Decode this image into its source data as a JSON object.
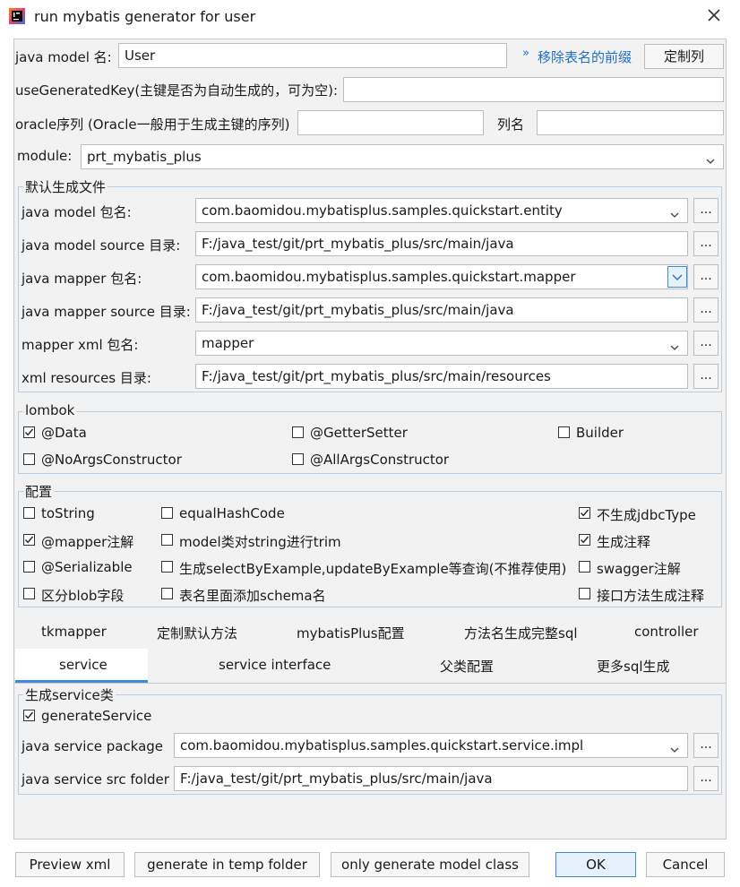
{
  "window": {
    "title": "run mybatis generator for user"
  },
  "model_row": {
    "label": "java model 名:",
    "value": "User",
    "remove_prefix_link": "移除表名的前缀",
    "custom_columns_button": "定制列"
  },
  "generated_key": {
    "label": "useGeneratedKey(主键是否为自动生成的，可为空):",
    "value": ""
  },
  "oracle": {
    "label": "oracle序列 (Oracle一般用于生成主键的序列)",
    "value": "",
    "column_label": "列名",
    "column_value": ""
  },
  "module": {
    "label": "module:",
    "value": "prt_mybatis_plus"
  },
  "default_files": {
    "title": "默认生成文件",
    "rows": [
      {
        "label": "java model 包名:",
        "value": "com.baomidou.mybatisplus.samples.quickstart.entity"
      },
      {
        "label": "java model source 目录:",
        "value": "F:/java_test/git/prt_mybatis_plus/src/main/java"
      },
      {
        "label": "java mapper 包名:",
        "value": "com.baomidou.mybatisplus.samples.quickstart.mapper"
      },
      {
        "label": "java mapper source 目录:",
        "value": "F:/java_test/git/prt_mybatis_plus/src/main/java"
      },
      {
        "label": "mapper xml 包名:",
        "value": "mapper"
      },
      {
        "label": "xml resources 目录:",
        "value": "F:/java_test/git/prt_mybatis_plus/src/main/resources"
      }
    ],
    "browse_label": "..."
  },
  "lombok": {
    "title": "lombok",
    "data": {
      "label": "@Data",
      "checked": true
    },
    "getter_setter": {
      "label": "@GetterSetter",
      "checked": false
    },
    "builder": {
      "label": "Builder",
      "checked": false
    },
    "no_args": {
      "label": "@NoArgsConstructor",
      "checked": false
    },
    "all_args": {
      "label": "@AllArgsConstructor",
      "checked": false
    }
  },
  "config": {
    "title": "配置",
    "to_string": {
      "label": "toString",
      "checked": false
    },
    "equal_hash_code": {
      "label": "equalHashCode",
      "checked": false
    },
    "no_jdbc_type": {
      "label": "不生成jdbcType",
      "checked": true
    },
    "mapper_annotation": {
      "label": "@mapper注解",
      "checked": true
    },
    "string_trim": {
      "label": "model类对string进行trim",
      "checked": false
    },
    "gen_comments": {
      "label": "生成注释",
      "checked": true
    },
    "serializable": {
      "label": "@Serializable",
      "checked": false
    },
    "select_by_example": {
      "label": "生成selectByExample,updateByExample等查询(不推荐使用)",
      "checked": false
    },
    "swagger": {
      "label": "swagger注解",
      "checked": false
    },
    "blob": {
      "label": "区分blob字段",
      "checked": false
    },
    "schema": {
      "label": "表名里面添加schema名",
      "checked": false
    },
    "interface_comments": {
      "label": "接口方法生成注释",
      "checked": false
    }
  },
  "tabs": {
    "tkmapper": "tkmapper",
    "custom_default": "定制默认方法",
    "mybatis_plus": "mybatisPlus配置",
    "full_sql": "方法名生成完整sql",
    "controller": "controller",
    "service": "service",
    "service_interface": "service interface",
    "parent_class": "父类配置",
    "more_sql": "更多sql生成",
    "active": "service"
  },
  "service_panel": {
    "title": "生成service类",
    "generate_service": {
      "label": "generateService",
      "checked": true
    },
    "package": {
      "label": "java service package",
      "value": "com.baomidou.mybatisplus.samples.quickstart.service.impl"
    },
    "src_folder": {
      "label": "java service src folder",
      "value": "F:/java_test/git/prt_mybatis_plus/src/main/java"
    }
  },
  "footer": {
    "preview": "Preview xml",
    "temp_folder": "generate in temp folder",
    "model_only": "only generate model class",
    "ok": "OK",
    "cancel": "Cancel"
  },
  "colors": {
    "accent": "#1f6fc5",
    "tab_underline": "#3c8be0",
    "group_border": "#b8cde6",
    "frame_bg": "#f2f2f2"
  }
}
